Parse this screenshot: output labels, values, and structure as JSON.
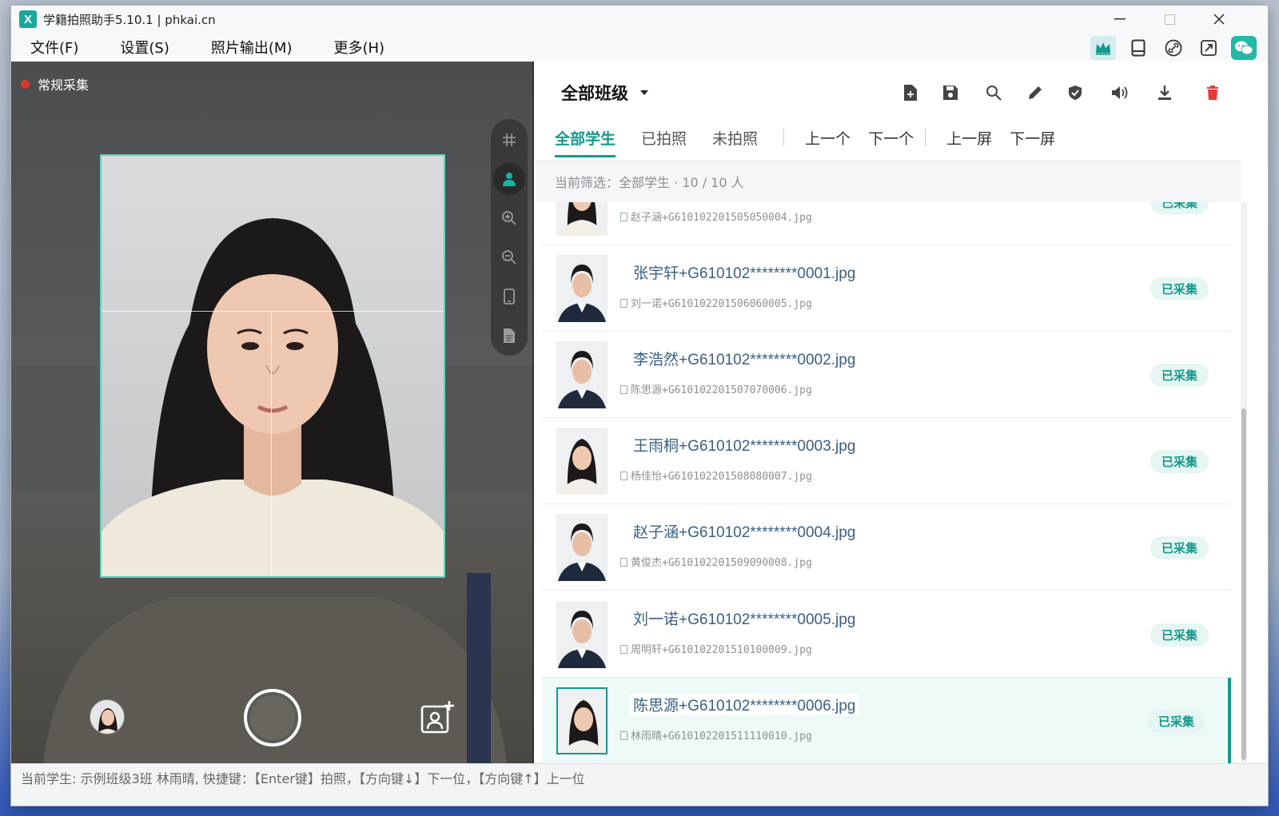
{
  "window": {
    "title": "学籍拍照助手5.10.1 | phkai.cn",
    "app_icon_text": "X"
  },
  "menu": [
    "文件(F)",
    "设置(S)",
    "照片输出(M)",
    "更多(H)"
  ],
  "toolbar_icons": [
    "crown-icon",
    "tablet-icon",
    "link-icon",
    "share-screen-icon",
    "wechat-icon"
  ],
  "camera": {
    "mode_label": "常规采集"
  },
  "panel": {
    "class_title": "全部班级",
    "tabs": [
      "全部学生",
      "已拍照",
      "未拍照"
    ],
    "nav": [
      "上一个",
      "下一个",
      "上一屏",
      "下一屏"
    ],
    "filter": "当前筛选：全部学生 · 10 / 10 人"
  },
  "students": [
    {
      "name": "",
      "file": "赵子涵+G610102201505050004.jpg",
      "status": "已采集",
      "selected": false,
      "gender": "f"
    },
    {
      "name": "张宇轩+G610102********0001.jpg",
      "file": "刘一诺+G610102201506060005.jpg",
      "status": "已采集",
      "selected": false,
      "gender": "m"
    },
    {
      "name": "李浩然+G610102********0002.jpg",
      "file": "陈思源+G610102201507070006.jpg",
      "status": "已采集",
      "selected": false,
      "gender": "m"
    },
    {
      "name": "王雨桐+G610102********0003.jpg",
      "file": "杨佳怡+G610102201508080007.jpg",
      "status": "已采集",
      "selected": false,
      "gender": "f"
    },
    {
      "name": "赵子涵+G610102********0004.jpg",
      "file": "黄俊杰+G610102201509090008.jpg",
      "status": "已采集",
      "selected": false,
      "gender": "m"
    },
    {
      "name": "刘一诺+G610102********0005.jpg",
      "file": "周明轩+G610102201510100009.jpg",
      "status": "已采集",
      "selected": false,
      "gender": "m"
    },
    {
      "name": "陈思源+G610102********0006.jpg",
      "file": "林雨晴+G610102201511110010.jpg",
      "status": "已采集",
      "selected": true,
      "gender": "f"
    }
  ],
  "statusbar": "当前学生: 示例班级3班 林雨晴, 快捷键：【Enter键】拍照，【方向键↓】下一位，【方向键↑】上一位",
  "colors": {
    "accent": "#14998c",
    "badge_bg": "#e5f6f3",
    "frame": "#5fd2bf",
    "delete": "#e53935"
  }
}
